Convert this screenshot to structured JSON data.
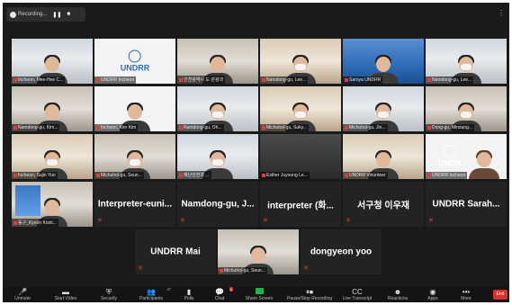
{
  "topbar": {
    "recording_label": "Recording...",
    "pause_icon": "pause-icon",
    "stop_icon": "stop-icon"
  },
  "colors": {
    "active_speaker": "#b7d74b",
    "end_button": "#d9322e",
    "share_screen": "#23b14d",
    "mute": "#e23b3b"
  },
  "participants": [
    {
      "name": "Incheon, Mee-Hee C...",
      "kind": "video",
      "icon": "video-feed"
    },
    {
      "name": "UNDRR Incheon",
      "kind": "logo",
      "logo_text": "UNDRR"
    },
    {
      "name": "인천광역시 도 관광과",
      "kind": "video"
    },
    {
      "name": "Namdong-gu, Lee...",
      "kind": "video"
    },
    {
      "name": "Saroya UNDRR",
      "kind": "video"
    },
    {
      "name": "Namdong-gu, Lee...",
      "kind": "video"
    },
    {
      "name": "Namdong-gu, Kim...",
      "kind": "video"
    },
    {
      "name": "Incheon, Kim Kim",
      "kind": "video"
    },
    {
      "name": "Namdong-gu, Oh...",
      "kind": "video"
    },
    {
      "name": "Michuhol-gu, Suky...",
      "kind": "video"
    },
    {
      "name": "Michuhol-gu, Jin...",
      "kind": "video"
    },
    {
      "name": "Dong-gu, Minsung...",
      "kind": "video"
    },
    {
      "name": "Incheon, Sujin Yun",
      "kind": "video"
    },
    {
      "name": "Michuhol-gu, Seun...",
      "kind": "video"
    },
    {
      "name": "재난안전과 ...",
      "kind": "video"
    },
    {
      "name": "Esther Juyoung Le...",
      "kind": "blank"
    },
    {
      "name": "UNDRR Volunteer",
      "kind": "video"
    },
    {
      "name": "UNDRR Incheon",
      "kind": "video",
      "logo_text": "UNDR"
    },
    {
      "name": "동구_Kyeon Kristi...",
      "kind": "video"
    },
    {
      "name": "Interpreter-euni...",
      "kind": "name"
    },
    {
      "name": "Namdong-gu, J...",
      "kind": "name"
    },
    {
      "name": "interpreter (화...",
      "kind": "name"
    },
    {
      "name": "서구청 이우재",
      "kind": "name"
    },
    {
      "name": "UNDRR Sarah...",
      "kind": "name"
    },
    {
      "name": "UNDRR Mai",
      "kind": "name"
    },
    {
      "name": "Michuhol-gu, Seun...",
      "kind": "video"
    },
    {
      "name": "dongyeon yoo",
      "kind": "name"
    }
  ],
  "toolbar": {
    "items": [
      {
        "label": "Unmute",
        "icon": "microphone-icon",
        "glyph": "🎤"
      },
      {
        "label": "Start Video",
        "icon": "video-camera-icon",
        "glyph": "▬"
      },
      {
        "label": "Security",
        "icon": "shield-icon",
        "glyph": "⛨"
      },
      {
        "label": "Participants",
        "icon": "participants-icon",
        "glyph": "👥",
        "count": "27"
      },
      {
        "label": "Polls",
        "icon": "polls-icon",
        "glyph": "▮"
      },
      {
        "label": "Chat",
        "icon": "chat-icon",
        "glyph": "💬",
        "badge": "1"
      },
      {
        "label": "Share Screen",
        "icon": "share-screen-icon",
        "glyph": ""
      },
      {
        "label": "Pause/Stop Recording",
        "icon": "recording-controls-icon",
        "glyph": "⏸⏹"
      },
      {
        "label": "Live Transcript",
        "icon": "cc-icon",
        "glyph": "CC"
      },
      {
        "label": "Reactions",
        "icon": "reactions-icon",
        "glyph": "☻"
      },
      {
        "label": "Apps",
        "icon": "apps-icon",
        "glyph": "◉"
      },
      {
        "label": "More",
        "icon": "more-icon",
        "glyph": "•••"
      }
    ],
    "end_label": "End"
  }
}
